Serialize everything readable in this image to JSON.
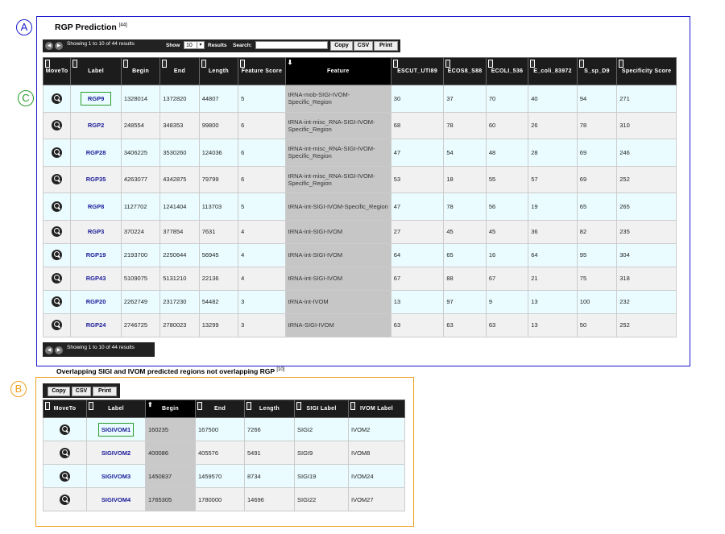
{
  "markers": {
    "a": "A",
    "b": "B",
    "c": "C"
  },
  "rgp": {
    "title": "RGP Prediction",
    "ref": "[44]",
    "info": "Showing 1 to 10 of 44 results",
    "info_bottom": "Showing 1 to 10 of 44 results",
    "show_label": "Show",
    "show_value": "10",
    "results_label": "Results",
    "search_label": "Search:",
    "search_value": "",
    "buttons": {
      "copy": "Copy",
      "csv": "CSV",
      "print": "Print"
    },
    "headers": [
      "MoveTo",
      "Label",
      "Begin",
      "End",
      "Length",
      "Feature Score",
      "Feature",
      "ESCUT_UTI89",
      "ECOS8_S88",
      "ECOLI_536",
      "E_coli_83972",
      "S_sp_D9",
      "Specificity Score"
    ],
    "rows": [
      [
        "RGP9",
        "1328014",
        "1372820",
        "44807",
        "5",
        "tRNA-mob-SIGI-IVOM-Specific_Region",
        "30",
        "37",
        "70",
        "40",
        "94",
        "271"
      ],
      [
        "RGP2",
        "248554",
        "348353",
        "99800",
        "6",
        "tRNA-int-misc_RNA-SIGI-IVOM-Specific_Region",
        "68",
        "78",
        "60",
        "26",
        "78",
        "310"
      ],
      [
        "RGP28",
        "3406225",
        "3530260",
        "124036",
        "6",
        "tRNA-int-misc_RNA-SIGI-IVOM-Specific_Region",
        "47",
        "54",
        "48",
        "28",
        "69",
        "246"
      ],
      [
        "RGP35",
        "4263077",
        "4342875",
        "79799",
        "6",
        "tRNA-int-misc_RNA-SIGI-IVOM-Specific_Region",
        "53",
        "18",
        "55",
        "57",
        "69",
        "252"
      ],
      [
        "RGP8",
        "1127702",
        "1241404",
        "113703",
        "5",
        "tRNA-int-SIGI-IVOM-Specific_Region",
        "47",
        "78",
        "56",
        "19",
        "65",
        "265"
      ],
      [
        "RGP3",
        "370224",
        "377854",
        "7631",
        "4",
        "tRNA-int-SIGI-IVOM",
        "27",
        "45",
        "45",
        "36",
        "82",
        "235"
      ],
      [
        "RGP19",
        "2193700",
        "2250644",
        "56945",
        "4",
        "tRNA-int-SIGI-IVOM",
        "64",
        "65",
        "16",
        "64",
        "95",
        "304"
      ],
      [
        "RGP43",
        "5109075",
        "5131210",
        "22136",
        "4",
        "tRNA-int-SIGI-IVOM",
        "67",
        "88",
        "67",
        "21",
        "75",
        "318"
      ],
      [
        "RGP20",
        "2262749",
        "2317230",
        "54482",
        "3",
        "tRNA-int-IVOM",
        "13",
        "97",
        "9",
        "13",
        "100",
        "232"
      ],
      [
        "RGP24",
        "2746725",
        "2780023",
        "13299",
        "3",
        "tRNA-SIGI-IVOM",
        "63",
        "63",
        "63",
        "13",
        "50",
        "252"
      ]
    ]
  },
  "sigi": {
    "title": "Overlapping SIGI and IVOM predicted regions not overlapping RGP",
    "ref": "[10]",
    "buttons": {
      "copy": "Copy",
      "csv": "CSV",
      "print": "Print"
    },
    "headers": [
      "MoveTo",
      "Label",
      "Begin",
      "End",
      "Length",
      "SIGI Label",
      "IVOM Label"
    ],
    "rows": [
      [
        "SIGIVOM1",
        "160235",
        "167500",
        "7266",
        "SIGI2",
        "IVOM2"
      ],
      [
        "SIGIVOM2",
        "400086",
        "405576",
        "5491",
        "SIGI9",
        "IVOM8"
      ],
      [
        "SIGIVOM3",
        "1450837",
        "1459570",
        "8734",
        "SIGI19",
        "IVOM24"
      ],
      [
        "SIGIVOM4",
        "1765305",
        "1780000",
        "14696",
        "SIGI22",
        "IVOM27"
      ]
    ]
  }
}
